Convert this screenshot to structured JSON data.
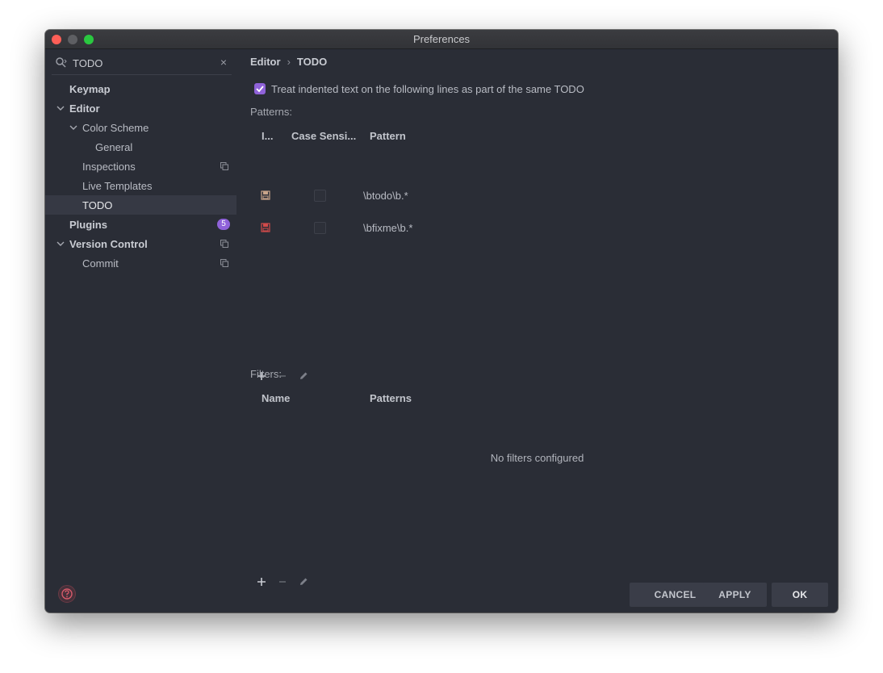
{
  "window": {
    "title": "Preferences"
  },
  "sidebar": {
    "search": {
      "value": "TODO",
      "clear": "×"
    },
    "items": [
      {
        "label": "Keymap"
      },
      {
        "label": "Editor"
      },
      {
        "label": "Color Scheme"
      },
      {
        "label": "General"
      },
      {
        "label": "Inspections"
      },
      {
        "label": "Live Templates"
      },
      {
        "label": "TODO"
      },
      {
        "label": "Plugins",
        "badge": "5"
      },
      {
        "label": "Version Control"
      },
      {
        "label": "Commit"
      }
    ]
  },
  "breadcrumb": {
    "parent": "Editor",
    "separator": "›",
    "current": "TODO"
  },
  "options": {
    "treat_indented_label": "Treat indented text on the following lines as part of the same TODO",
    "treat_indented_checked": true
  },
  "patterns": {
    "label": "Patterns:",
    "columns": [
      "I...",
      "Case Sensi...",
      "Pattern"
    ],
    "rows": [
      {
        "pattern": "\\btodo\\b.*",
        "case_sensitive": false,
        "icon_color": "#c9a48a"
      },
      {
        "pattern": "\\bfixme\\b.*",
        "case_sensitive": false,
        "icon_color": "#d24a4a"
      }
    ]
  },
  "filters": {
    "label": "Filters:",
    "columns": [
      "Name",
      "Patterns"
    ],
    "empty_message": "No filters configured"
  },
  "buttons": {
    "cancel": "CANCEL",
    "apply": "APPLY",
    "ok": "OK"
  },
  "colors": {
    "accent": "#8f62d9",
    "background": "#2a2d36",
    "button": "#3a3d48"
  }
}
